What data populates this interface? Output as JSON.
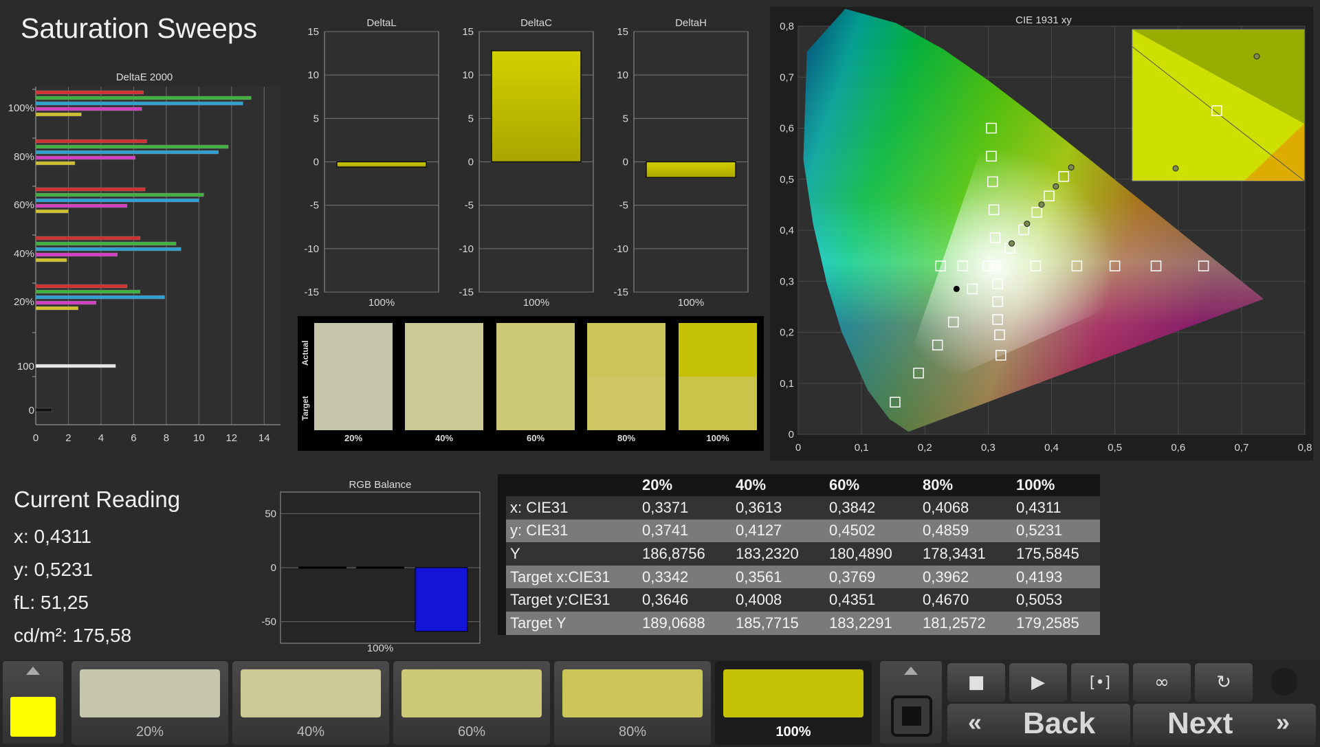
{
  "app": {
    "title": "Saturation Sweeps"
  },
  "colors": {
    "accent_yellow": "#c4c000",
    "bright_yellow": "#ffff00",
    "rgb_blue": "#1414d8",
    "panel_bg": "#2b2b2b"
  },
  "deltaE_chart": {
    "title": "DeltaE 2000",
    "y_labels": [
      "100%",
      "80%",
      "60%",
      "40%",
      "20%",
      "100",
      "0"
    ],
    "x_ticks": [
      "0",
      "2",
      "4",
      "6",
      "8",
      "10",
      "12",
      "14"
    ],
    "groups": [
      {
        "label": "100%",
        "values": [
          6.6,
          13.2,
          12.7,
          6.5,
          2.8
        ]
      },
      {
        "label": "80%",
        "values": [
          6.8,
          11.8,
          11.2,
          6.1,
          2.4
        ]
      },
      {
        "label": "60%",
        "values": [
          6.7,
          10.3,
          10.0,
          5.6,
          2.0
        ]
      },
      {
        "label": "40%",
        "values": [
          6.4,
          8.6,
          8.9,
          5.0,
          1.9
        ]
      },
      {
        "label": "20%",
        "values": [
          5.6,
          6.4,
          7.9,
          3.7,
          2.6
        ]
      },
      {
        "label": "100",
        "values": [
          4.9
        ]
      },
      {
        "label": "0",
        "values": [
          1.0
        ]
      }
    ],
    "series_colors": [
      "#d03030",
      "#40b040",
      "#30a0d0",
      "#d040c0",
      "#d0c030"
    ]
  },
  "delta_panels": [
    {
      "title": "DeltaL",
      "value": -0.6,
      "xlabel": "100%"
    },
    {
      "title": "DeltaC",
      "value": 12.8,
      "xlabel": "100%"
    },
    {
      "title": "DeltaH",
      "value": -1.8,
      "xlabel": "100%"
    }
  ],
  "delta_ticks": [
    "15",
    "10",
    "5",
    "0",
    "-5",
    "-10",
    "-15"
  ],
  "swatches": {
    "actual_label": "Actual",
    "target_label": "Target",
    "items": [
      {
        "label": "20%",
        "actual": "#c6c6ac",
        "target": "#c6c6ac"
      },
      {
        "label": "40%",
        "actual": "#cbc994",
        "target": "#cbc994"
      },
      {
        "label": "60%",
        "actual": "#cdc778",
        "target": "#cdc778"
      },
      {
        "label": "80%",
        "actual": "#cbc55a",
        "target": "#cdc663"
      },
      {
        "label": "100%",
        "actual": "#c5c206",
        "target": "#cbc44a"
      }
    ]
  },
  "cie": {
    "title": "CIE 1931 xy",
    "x_ticks": [
      "0",
      "0,1",
      "0,2",
      "0,3",
      "0,4",
      "0,5",
      "0,6",
      "0,7",
      "0,8"
    ],
    "y_ticks": [
      "0",
      "0,1",
      "0,2",
      "0,3",
      "0,4",
      "0,5",
      "0,6",
      "0,7",
      "0,8"
    ],
    "gamut": [
      [
        0.64,
        0.33
      ],
      [
        0.3,
        0.6
      ],
      [
        0.15,
        0.06
      ]
    ],
    "white": [
      0.3127,
      0.329
    ],
    "targets": [
      [
        0.3342,
        0.3646
      ],
      [
        0.3561,
        0.4008
      ],
      [
        0.3769,
        0.4351
      ],
      [
        0.3962,
        0.467
      ],
      [
        0.4193,
        0.5053
      ]
    ],
    "measured": [
      [
        0.3371,
        0.3741
      ],
      [
        0.3613,
        0.4127
      ],
      [
        0.3842,
        0.4502
      ],
      [
        0.4068,
        0.4859
      ],
      [
        0.4311,
        0.5231
      ]
    ]
  },
  "current": {
    "heading": "Current Reading",
    "x": "x: 0,4311",
    "y": "y: 0,5231",
    "fl": "fL: 51,25",
    "cd": "cd/m²: 175,58"
  },
  "rgb_balance": {
    "title": "RGB Balance",
    "ticks": [
      "50",
      "0",
      "-50"
    ],
    "xlabel": "100%",
    "red": 0,
    "green": 0,
    "blue": -59
  },
  "readings": {
    "columns": [
      "",
      "20%",
      "40%",
      "60%",
      "80%",
      "100%"
    ],
    "rows": [
      {
        "label": "x: CIE31",
        "values": [
          "0,3371",
          "0,3613",
          "0,3842",
          "0,4068",
          "0,4311"
        ]
      },
      {
        "label": "y: CIE31",
        "values": [
          "0,3741",
          "0,4127",
          "0,4502",
          "0,4859",
          "0,5231"
        ]
      },
      {
        "label": "Y",
        "values": [
          "186,8756",
          "183,2320",
          "180,4890",
          "178,3431",
          "175,5845"
        ]
      },
      {
        "label": "Target x:CIE31",
        "values": [
          "0,3342",
          "0,3561",
          "0,3769",
          "0,3962",
          "0,4193"
        ]
      },
      {
        "label": "Target y:CIE31",
        "values": [
          "0,3646",
          "0,4008",
          "0,4351",
          "0,4670",
          "0,5053"
        ]
      },
      {
        "label": "Target Y",
        "values": [
          "189,0688",
          "185,7715",
          "183,2291",
          "181,2572",
          "179,2585"
        ]
      }
    ]
  },
  "toolbar": {
    "tiles": [
      {
        "label": "20%",
        "color": "#c6c6ac"
      },
      {
        "label": "40%",
        "color": "#cbc994"
      },
      {
        "label": "60%",
        "color": "#cdc778"
      },
      {
        "label": "80%",
        "color": "#cbc55a"
      },
      {
        "label": "100%",
        "color": "#c5c206"
      }
    ],
    "back_label": "Back",
    "next_label": "Next"
  }
}
